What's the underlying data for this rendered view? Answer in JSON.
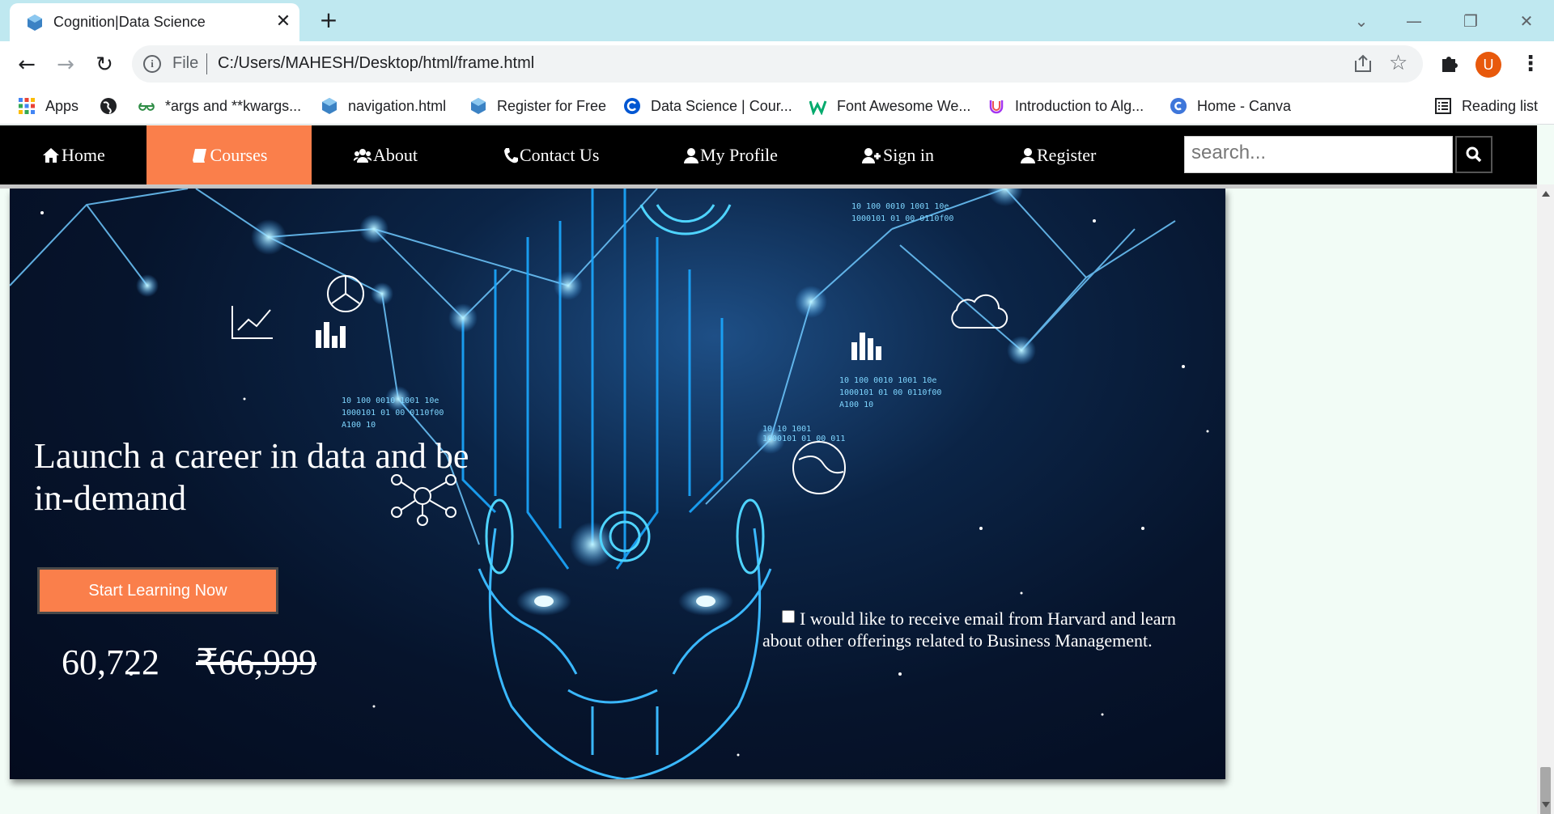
{
  "browser": {
    "tab_title": "Cognition|Data Science",
    "tab_close": "✕",
    "new_tab": "+",
    "address_scheme": "File",
    "address_url": "C:/Users/MAHESH/Desktop/html/frame.html",
    "avatar_letter": "U",
    "bookmarks": [
      {
        "label": "Apps",
        "icon": "apps-grid-icon"
      },
      {
        "label": "",
        "icon": "globe-icon"
      },
      {
        "label": "*args and **kwargs...",
        "icon": "geeksforgeeks-icon"
      },
      {
        "label": "navigation.html",
        "icon": "file-icon"
      },
      {
        "label": "Register for Free",
        "icon": "file-icon"
      },
      {
        "label": "Data Science | Cour...",
        "icon": "coursera-icon"
      },
      {
        "label": "Font Awesome We...",
        "icon": "w3schools-icon"
      },
      {
        "label": "Introduction to Alg...",
        "icon": "udemy-icon"
      },
      {
        "label": "Home - Canva",
        "icon": "canva-icon"
      }
    ],
    "reading_list": "Reading list"
  },
  "site_nav": {
    "items": [
      {
        "label": "Home",
        "icon": "home-icon"
      },
      {
        "label": "Courses",
        "icon": "book-icon",
        "active": true
      },
      {
        "label": "About",
        "icon": "users-icon"
      },
      {
        "label": "Contact Us",
        "icon": "phone-icon"
      },
      {
        "label": "My Profile",
        "icon": "user-icon"
      },
      {
        "label": "Sign in",
        "icon": "user-plus-icon"
      },
      {
        "label": "Register",
        "icon": "user-icon"
      }
    ],
    "search_placeholder": "search..."
  },
  "hero": {
    "title": "Launch a career in data and be in-demand",
    "cta_label": "Start Learning Now",
    "price_current": "60,722",
    "price_old": "₹66,999",
    "consent_text": "I would like to receive email from Harvard and learn about other offerings related to Business Management."
  },
  "colors": {
    "accent": "#fa7f4b",
    "nav_bg": "#000000",
    "page_bg": "#f2fcf6",
    "tab_strip": "#bfe8f0"
  }
}
